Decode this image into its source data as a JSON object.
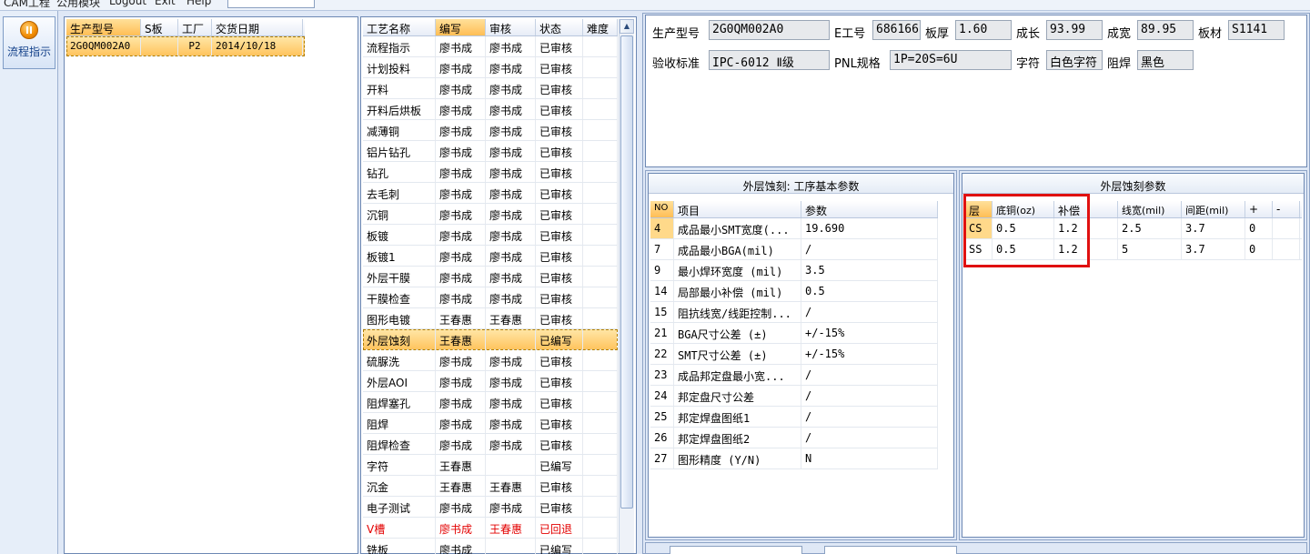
{
  "menubar": {
    "items": [
      "CAM工程",
      "公用模块",
      "Logout",
      "Exit",
      "Help"
    ]
  },
  "nav": {
    "flow_button_label": "流程指示"
  },
  "orders": {
    "columns": [
      "生产型号",
      "S板",
      "工厂",
      "交货日期"
    ],
    "rows": [
      {
        "model": "2G0QM002A0",
        "s": "",
        "factory": "P2",
        "date": "2014/10/18"
      }
    ]
  },
  "process": {
    "columns": [
      "工艺名称",
      "编写",
      "审核",
      "状态",
      "难度"
    ],
    "rows": [
      {
        "name": "流程指示",
        "writer": "廖书成",
        "reviewer": "廖书成",
        "status": "已审核"
      },
      {
        "name": "计划投料",
        "writer": "廖书成",
        "reviewer": "廖书成",
        "status": "已审核"
      },
      {
        "name": "开料",
        "writer": "廖书成",
        "reviewer": "廖书成",
        "status": "已审核"
      },
      {
        "name": "开料后烘板",
        "writer": "廖书成",
        "reviewer": "廖书成",
        "status": "已审核"
      },
      {
        "name": "减薄铜",
        "writer": "廖书成",
        "reviewer": "廖书成",
        "status": "已审核"
      },
      {
        "name": "铝片钻孔",
        "writer": "廖书成",
        "reviewer": "廖书成",
        "status": "已审核"
      },
      {
        "name": "钻孔",
        "writer": "廖书成",
        "reviewer": "廖书成",
        "status": "已审核"
      },
      {
        "name": "去毛刺",
        "writer": "廖书成",
        "reviewer": "廖书成",
        "status": "已审核"
      },
      {
        "name": "沉铜",
        "writer": "廖书成",
        "reviewer": "廖书成",
        "status": "已审核"
      },
      {
        "name": "板镀",
        "writer": "廖书成",
        "reviewer": "廖书成",
        "status": "已审核"
      },
      {
        "name": "板镀1",
        "writer": "廖书成",
        "reviewer": "廖书成",
        "status": "已审核"
      },
      {
        "name": "外层干膜",
        "writer": "廖书成",
        "reviewer": "廖书成",
        "status": "已审核"
      },
      {
        "name": "干膜检查",
        "writer": "廖书成",
        "reviewer": "廖书成",
        "status": "已审核"
      },
      {
        "name": "图形电镀",
        "writer": "王春惠",
        "reviewer": "王春惠",
        "status": "已审核"
      },
      {
        "name": "外层蚀刻",
        "writer": "王春惠",
        "reviewer": "",
        "status": "已编写"
      },
      {
        "name": "硫脲洗",
        "writer": "廖书成",
        "reviewer": "廖书成",
        "status": "已审核"
      },
      {
        "name": "外层AOI",
        "writer": "廖书成",
        "reviewer": "廖书成",
        "status": "已审核"
      },
      {
        "name": "阻焊塞孔",
        "writer": "廖书成",
        "reviewer": "廖书成",
        "status": "已审核"
      },
      {
        "name": "阻焊",
        "writer": "廖书成",
        "reviewer": "廖书成",
        "status": "已审核"
      },
      {
        "name": "阻焊检查",
        "writer": "廖书成",
        "reviewer": "廖书成",
        "status": "已审核"
      },
      {
        "name": "字符",
        "writer": "王春惠",
        "reviewer": "",
        "status": "已编写"
      },
      {
        "name": "沉金",
        "writer": "王春惠",
        "reviewer": "王春惠",
        "status": "已审核"
      },
      {
        "name": "电子测试",
        "writer": "廖书成",
        "reviewer": "廖书成",
        "status": "已审核"
      },
      {
        "name": "V槽",
        "writer": "廖书成",
        "reviewer": "王春惠",
        "status": "已回退"
      },
      {
        "name": "铣板",
        "writer": "廖书成",
        "reviewer": "",
        "status": "已编写"
      }
    ]
  },
  "info": {
    "labels": {
      "model": "生产型号",
      "e_no": "E工号",
      "thickness": "板厚",
      "length": "成长",
      "width": "成宽",
      "material": "板材",
      "standard": "验收标准",
      "pnl": "PNL规格",
      "char": "字符",
      "solder": "阻焊"
    },
    "values": {
      "model": "2G0QM002A0",
      "e_no": "686166",
      "thickness": "1.60",
      "length": "93.99",
      "width": "89.95",
      "material": "S1141",
      "standard": "IPC-6012 Ⅱ级",
      "pnl": "1P=20S=6U",
      "char": "白色字符",
      "solder": "黑色"
    }
  },
  "basic_params": {
    "title": "外层蚀刻: 工序基本参数",
    "columns": [
      "NO",
      "项目",
      "参数"
    ],
    "rows": [
      {
        "no": "4",
        "item": "成品最小SMT宽度(...",
        "value": "19.690"
      },
      {
        "no": "7",
        "item": "成品最小BGA(mil)",
        "value": "/"
      },
      {
        "no": "9",
        "item": "最小焊环宽度 (mil)",
        "value": "3.5"
      },
      {
        "no": "14",
        "item": "局部最小补偿 (mil)",
        "value": "0.5"
      },
      {
        "no": "15",
        "item": "阻抗线宽/线距控制...",
        "value": "/"
      },
      {
        "no": "21",
        "item": "BGA尺寸公差 (±)",
        "value": "+/-15%"
      },
      {
        "no": "22",
        "item": "SMT尺寸公差 (±)",
        "value": "+/-15%"
      },
      {
        "no": "23",
        "item": "成品邦定盘最小宽...",
        "value": "/"
      },
      {
        "no": "24",
        "item": "邦定盘尺寸公差",
        "value": "/"
      },
      {
        "no": "25",
        "item": "邦定焊盘图纸1",
        "value": "/"
      },
      {
        "no": "26",
        "item": "邦定焊盘图纸2",
        "value": "/"
      },
      {
        "no": "27",
        "item": "图形精度 (Y/N)",
        "value": "N"
      }
    ]
  },
  "etch_params": {
    "title": "外层蚀刻参数",
    "columns": [
      "层",
      "底铜(oz)",
      "补偿",
      "线宽(mil)",
      "间距(mil)",
      "+",
      "-"
    ],
    "rows": [
      {
        "layer": "CS",
        "copper": "0.5",
        "comp": "1.2",
        "width": "2.5",
        "gap": "3.7",
        "plus": "0",
        "minus": ""
      },
      {
        "layer": "SS",
        "copper": "0.5",
        "comp": "1.2",
        "width": "5",
        "gap": "3.7",
        "plus": "0",
        "minus": ""
      }
    ]
  }
}
